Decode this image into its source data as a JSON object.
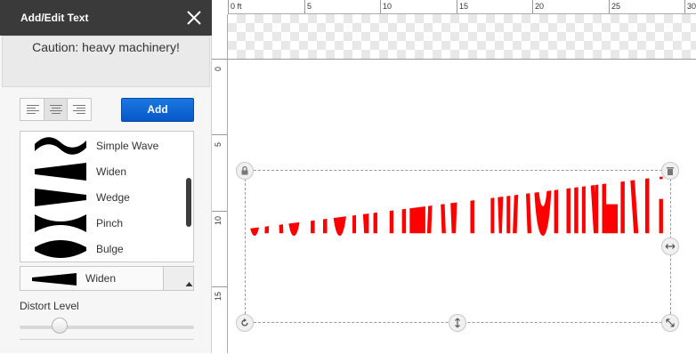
{
  "panel": {
    "title": "Add/Edit Text",
    "text_value": "Caution: heavy machinery!",
    "add_label": "Add",
    "shapes": [
      {
        "label": "Simple Wave",
        "icon": "simple-wave-icon"
      },
      {
        "label": "Widen",
        "icon": "widen-icon"
      },
      {
        "label": "Wedge",
        "icon": "wedge-icon"
      },
      {
        "label": "Pinch",
        "icon": "pinch-icon"
      },
      {
        "label": "Bulge",
        "icon": "bulge-icon"
      }
    ],
    "selected_shape": "Widen",
    "distort_label": "Distort Level",
    "distort_level": 0.2
  },
  "ruler": {
    "top_labels": [
      "0 ft",
      "5",
      "10",
      "15",
      "20",
      "25",
      "30"
    ],
    "left_labels": [
      "0",
      "5",
      "10",
      "15"
    ]
  },
  "canvas": {
    "art_text": "CAUTION: HEAVY MACHINERY!",
    "text_color": "#ff0000"
  },
  "colors": {
    "accent": "#0857c9",
    "header": "#3a3a3a"
  }
}
